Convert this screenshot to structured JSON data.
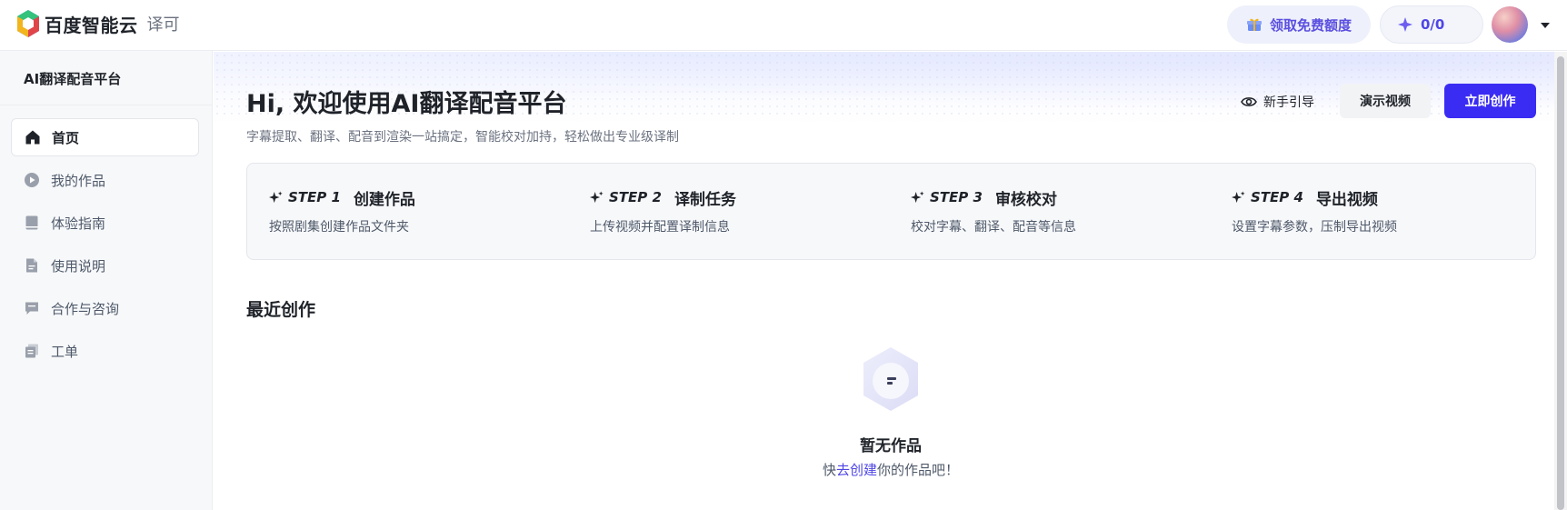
{
  "header": {
    "brand": "百度智能云",
    "product": "译可",
    "free_quota_label": "领取免费额度",
    "quota_value": "0/0",
    "icons": {
      "logo": "baidu-cloud-logo",
      "gift": "gift-icon",
      "sparkle": "sparkle-icon",
      "caret": "caret-down-icon"
    }
  },
  "sidebar": {
    "title": "AI翻译配音平台",
    "items": [
      {
        "label": "首页",
        "icon": "home-icon",
        "active": true
      },
      {
        "label": "我的作品",
        "icon": "play-circle-icon",
        "active": false
      },
      {
        "label": "体验指南",
        "icon": "book-icon",
        "active": false
      },
      {
        "label": "使用说明",
        "icon": "document-icon",
        "active": false
      },
      {
        "label": "合作与咨询",
        "icon": "chat-icon",
        "active": false
      },
      {
        "label": "工单",
        "icon": "ticket-icon",
        "active": false
      }
    ]
  },
  "main": {
    "title": "Hi, 欢迎使用AI翻译配音平台",
    "subtitle": "字幕提取、翻译、配音到渲染一站搞定，智能校对加持，轻松做出专业级译制",
    "actions": {
      "guide_label": "新手引导",
      "demo_label": "演示视频",
      "create_label": "立即创作"
    },
    "steps": [
      {
        "no": "STEP 1",
        "name": "创建作品",
        "desc": "按照剧集创建作品文件夹"
      },
      {
        "no": "STEP 2",
        "name": "译制任务",
        "desc": "上传视频并配置译制信息"
      },
      {
        "no": "STEP 3",
        "name": "审核校对",
        "desc": "校对字幕、翻译、配音等信息"
      },
      {
        "no": "STEP 4",
        "name": "导出视频",
        "desc": "设置字幕参数，压制导出视频"
      }
    ],
    "recent": {
      "title": "最近创作",
      "empty_title": "暂无作品",
      "empty_prefix": "快",
      "empty_link": "去创建",
      "empty_suffix": "你的作品吧！"
    }
  },
  "colors": {
    "primary": "#3b2cf3",
    "accent_text": "#4f46e5",
    "sidebar_bg": "#f7f8fa"
  }
}
